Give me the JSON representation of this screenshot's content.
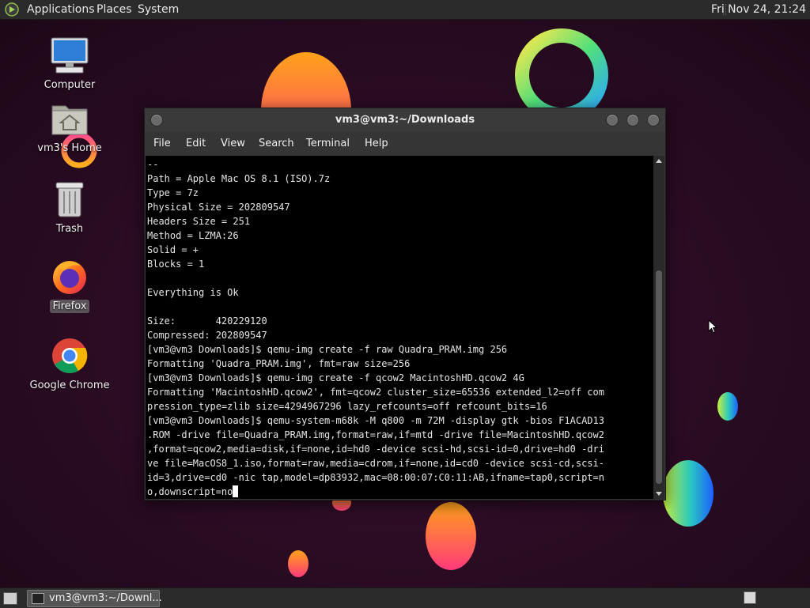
{
  "top_panel": {
    "menus": [
      "Applications",
      "Places",
      "System"
    ],
    "clock": "Fri Nov 24, 21:24"
  },
  "desktop_icons": [
    {
      "label": "Computer",
      "icon": "computer-icon"
    },
    {
      "label": "vm3's Home",
      "icon": "home-folder-icon"
    },
    {
      "label": "Trash",
      "icon": "trash-icon"
    },
    {
      "label": "Firefox",
      "icon": "firefox-icon",
      "selected": true
    },
    {
      "label": "Google Chrome",
      "icon": "chrome-icon"
    }
  ],
  "terminal": {
    "title": "vm3@vm3:~/Downloads",
    "menu": [
      "File",
      "Edit",
      "View",
      "Search",
      "Terminal",
      "Help"
    ],
    "lines": [
      "--",
      "Path = Apple Mac OS 8.1 (ISO).7z",
      "Type = 7z",
      "Physical Size = 202809547",
      "Headers Size = 251",
      "Method = LZMA:26",
      "Solid = +",
      "Blocks = 1",
      "",
      "Everything is Ok",
      "",
      "Size:       420229120",
      "Compressed: 202809547",
      "[vm3@vm3 Downloads]$ qemu-img create -f raw Quadra_PRAM.img 256",
      "Formatting 'Quadra_PRAM.img', fmt=raw size=256",
      "[vm3@vm3 Downloads]$ qemu-img create -f qcow2 MacintoshHD.qcow2 4G",
      "Formatting 'MacintoshHD.qcow2', fmt=qcow2 cluster_size=65536 extended_l2=off com",
      "pression_type=zlib size=4294967296 lazy_refcounts=off refcount_bits=16",
      "[vm3@vm3 Downloads]$ qemu-system-m68k -M q800 -m 72M -display gtk -bios F1ACAD13",
      ".ROM -drive file=Quadra_PRAM.img,format=raw,if=mtd -drive file=MacintoshHD.qcow2",
      ",format=qcow2,media=disk,if=none,id=hd0 -device scsi-hd,scsi-id=0,drive=hd0 -dri",
      "ve file=MacOS8_1.iso,format=raw,media=cdrom,if=none,id=cd0 -device scsi-cd,scsi-",
      "id=3,drive=cd0 -nic tap,model=dp83932,mac=08:00:07:C0:11:AB,ifname=tap0,script=n",
      "o,downscript=no"
    ]
  },
  "taskbar": {
    "window_button": "vm3@vm3:~/Downl..."
  },
  "colors": {
    "panel": "#2b2b2b",
    "terminal_bg": "#000000",
    "terminal_fg": "#e6e6e6",
    "wallpaper": "#2a0c22"
  }
}
